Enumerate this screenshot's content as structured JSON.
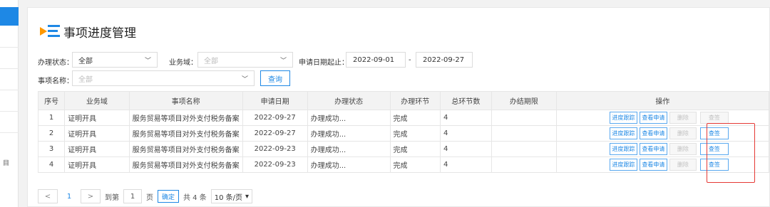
{
  "page": {
    "title": "事项进度管理"
  },
  "filters": {
    "status_label": "办理状态：",
    "status_value": "全部",
    "domain_label": "业务域：",
    "domain_placeholder": "全部",
    "date_label": "申请日期起止：",
    "date_start": "2022-09-01",
    "date_sep": "-",
    "date_end": "2022-09-27",
    "name_label": "事项名称：",
    "name_placeholder": "全部",
    "query_label": "查询"
  },
  "table": {
    "headers": [
      "序号",
      "业务域",
      "事项名称",
      "申请日期",
      "办理状态",
      "办理环节",
      "总环节数",
      "办结期限",
      "操作"
    ],
    "rows": [
      {
        "idx": "1",
        "domain": "证明开具",
        "name": "服务贸易等项目对外支付税务备案",
        "date": "2022-09-27",
        "status": "办理成功...",
        "step": "完成",
        "total": "4",
        "deadline": ""
      },
      {
        "idx": "2",
        "domain": "证明开具",
        "name": "服务贸易等项目对外支付税务备案",
        "date": "2022-09-27",
        "status": "办理成功...",
        "step": "完成",
        "total": "4",
        "deadline": ""
      },
      {
        "idx": "3",
        "domain": "证明开具",
        "name": "服务贸易等项目对外支付税务备案",
        "date": "2022-09-23",
        "status": "办理成功...",
        "step": "完成",
        "total": "4",
        "deadline": ""
      },
      {
        "idx": "4",
        "domain": "证明开具",
        "name": "服务贸易等项目对外支付税务备案",
        "date": "2022-09-23",
        "status": "办理成功...",
        "step": "完成",
        "total": "4",
        "deadline": ""
      }
    ],
    "actions": {
      "track": "进度跟踪",
      "view": "查看申请",
      "delete": "删除",
      "sign": "查签"
    }
  },
  "pagination": {
    "prev": "<",
    "current": "1",
    "next": ">",
    "goto_label": "到第",
    "page_input": "1",
    "page_unit": "页",
    "confirm": "确定",
    "total": "共 4 条",
    "page_size": "10 条/页",
    "page_size_arrow": "▾"
  },
  "sidebar": {
    "glyph": "目"
  },
  "colors": {
    "accent": "#1e88e5",
    "highlight": "#e53935",
    "icon_orange": "#ff9800"
  }
}
